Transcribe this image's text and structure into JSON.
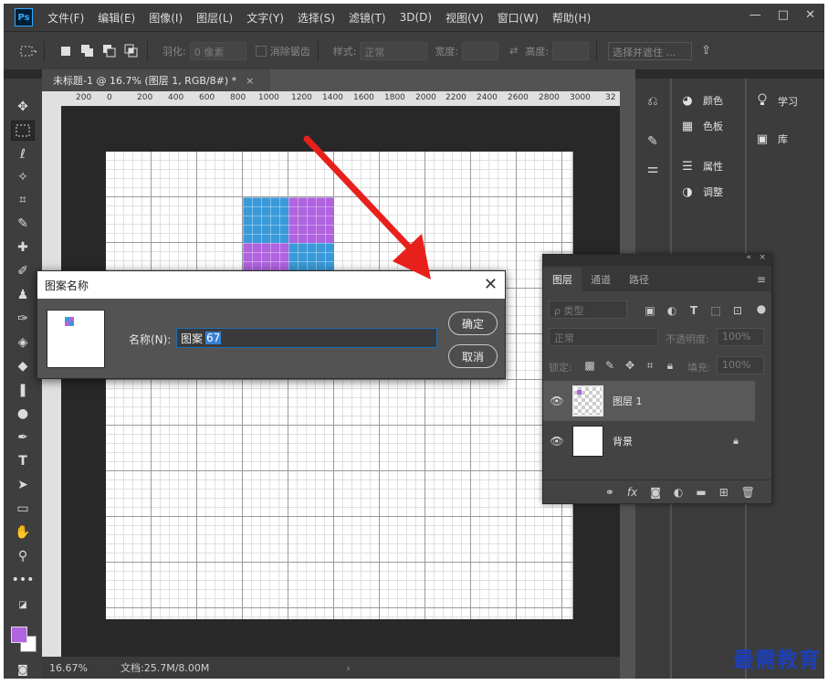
{
  "app": {
    "logo": "Ps"
  },
  "menu": [
    "文件(F)",
    "编辑(E)",
    "图像(I)",
    "图层(L)",
    "文字(Y)",
    "选择(S)",
    "滤镜(T)",
    "3D(D)",
    "视图(V)",
    "窗口(W)",
    "帮助(H)"
  ],
  "window_controls": {
    "minimize": "—",
    "restore": "□",
    "close": "✕"
  },
  "options": {
    "feather_label": "羽化:",
    "feather_value": "0 像素",
    "antialias_label": "消除锯齿",
    "style_label": "样式:",
    "style_value": "正常",
    "width_label": "宽度:",
    "height_label": "高度:",
    "select_mask_label": "选择并遮住 ..."
  },
  "document": {
    "tab_title": "未标题-1 @ 16.7% (图层 1, RGB/8#) *",
    "tab_close": "×",
    "zoom": "16.67%",
    "doc_info": "文档:25.7M/8.00M",
    "status_arrow": "›"
  },
  "ruler_ticks": [
    "200",
    "0",
    "200",
    "400",
    "600",
    "800",
    "1000",
    "1200",
    "1400",
    "1600",
    "1800",
    "2000",
    "2200",
    "2400",
    "2600",
    "2800",
    "3000",
    "32"
  ],
  "pattern_colors": {
    "blue": "#3a9ad9",
    "purple": "#b064e0"
  },
  "right_panels": {
    "col2": [
      {
        "icon": "palette-icon",
        "glyph": "◕",
        "label": "颜色"
      },
      {
        "icon": "swatches-icon",
        "glyph": "▦",
        "label": "色板"
      },
      {
        "icon": "properties-icon",
        "glyph": "☰",
        "label": "属性"
      },
      {
        "icon": "adjustments-icon",
        "glyph": "◑",
        "label": "调整"
      }
    ],
    "col3": [
      {
        "icon": "learn-icon",
        "glyph": "💡",
        "label": "学习"
      },
      {
        "icon": "library-icon",
        "glyph": "▣",
        "label": "库"
      }
    ]
  },
  "layers_panel": {
    "tabs": [
      "图层",
      "通道",
      "路径"
    ],
    "filter_kind": "ρ 类型",
    "blend_mode": "正常",
    "opacity_label": "不透明度:",
    "opacity_value": "100%",
    "lock_label": "锁定:",
    "fill_label": "填充:",
    "fill_value": "100%",
    "layers": [
      {
        "name": "图层 1",
        "selected": true
      },
      {
        "name": "背景",
        "selected": false
      }
    ]
  },
  "dialog": {
    "title": "图案名称",
    "name_label": "名称(N):",
    "name_value_prefix": "图案",
    "name_value_selected": "67",
    "ok_label": "确定",
    "cancel_label": "取消"
  },
  "accent": {
    "arrow_red": "#e8201c",
    "fg_swatch": "#b064e0"
  },
  "watermark": "最需教育"
}
